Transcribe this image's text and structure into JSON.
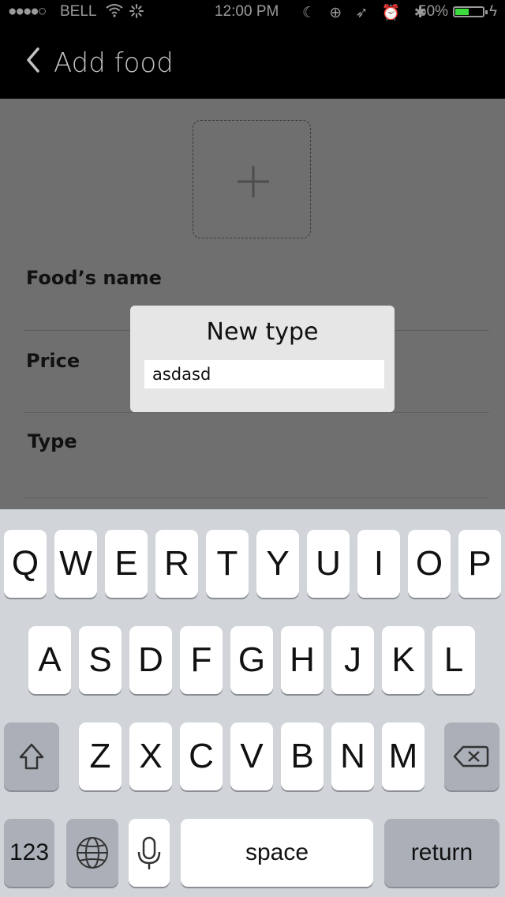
{
  "status_bar": {
    "signal": "●●●●○",
    "carrier": "BELL",
    "wifi_icon": "wifi-icon",
    "activity_icon": "activity-spinner-icon",
    "time": "12:00 PM",
    "icons": "☾ ⊕ ➶ ⏰ ✱",
    "battery_percent": "50%",
    "battery_level": 0.5,
    "charging_icon": "ϟ",
    "battery_color": "#3ddc3d"
  },
  "nav": {
    "back_icon": "chevron-left-icon",
    "title": "Add food"
  },
  "form": {
    "photo_icon": "plus-icon",
    "fields": [
      {
        "label": "Food’s name"
      },
      {
        "label": "Price"
      },
      {
        "label": "Type"
      }
    ]
  },
  "dialog": {
    "title": "New type",
    "input_value": "asdasd"
  },
  "keyboard": {
    "row1": [
      "Q",
      "W",
      "E",
      "R",
      "T",
      "Y",
      "U",
      "I",
      "O",
      "P"
    ],
    "row2": [
      "A",
      "S",
      "D",
      "F",
      "G",
      "H",
      "J",
      "K",
      "L"
    ],
    "row3": [
      "Z",
      "X",
      "C",
      "V",
      "B",
      "N",
      "M"
    ],
    "shift_icon": "shift-icon",
    "delete_icon": "delete-icon",
    "numbers_label": "123",
    "globe_icon": "globe-icon",
    "mic_icon": "microphone-icon",
    "space_label": "space",
    "return_label": "return"
  }
}
